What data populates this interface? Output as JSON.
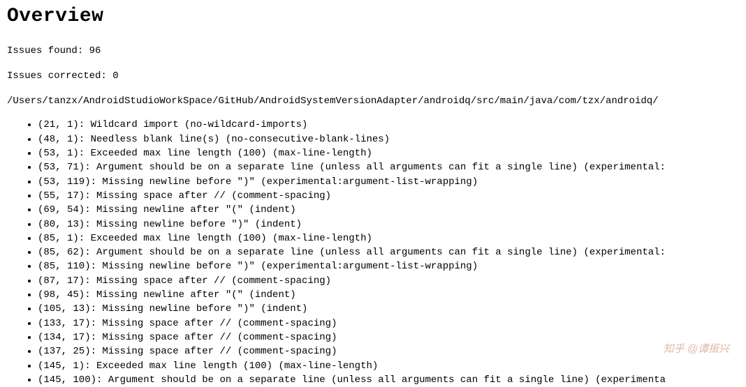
{
  "heading": "Overview",
  "issues_found_label": "Issues found:",
  "issues_found_count": "96",
  "issues_corrected_label": "Issues corrected:",
  "issues_corrected_count": "0",
  "file_path": "/Users/tanzx/AndroidStudioWorkSpace/GitHub/AndroidSystemVersionAdapter/androidq/src/main/java/com/tzx/androidq/",
  "issues": [
    {
      "text": "(21, 1): Wildcard import (no-wildcard-imports)"
    },
    {
      "text": "(48, 1): Needless blank line(s) (no-consecutive-blank-lines)"
    },
    {
      "text": "(53, 1): Exceeded max line length (100) (max-line-length)"
    },
    {
      "text": "(53, 71): Argument should be on a separate line (unless all arguments can fit a single line) (experimental:"
    },
    {
      "text": "(53, 119): Missing newline before \")\" (experimental:argument-list-wrapping)"
    },
    {
      "text": "(55, 17): Missing space after // (comment-spacing)"
    },
    {
      "text": "(69, 54): Missing newline after \"(\" (indent)"
    },
    {
      "text": "(80, 13): Missing newline before \")\" (indent)"
    },
    {
      "text": "(85, 1): Exceeded max line length (100) (max-line-length)"
    },
    {
      "text": "(85, 62): Argument should be on a separate line (unless all arguments can fit a single line) (experimental:"
    },
    {
      "text": "(85, 110): Missing newline before \")\" (experimental:argument-list-wrapping)"
    },
    {
      "text": "(87, 17): Missing space after // (comment-spacing)"
    },
    {
      "text": "(98, 45): Missing newline after \"(\" (indent)"
    },
    {
      "text": "(105, 13): Missing newline before \")\" (indent)"
    },
    {
      "text": "(133, 17): Missing space after // (comment-spacing)"
    },
    {
      "text": "(134, 17): Missing space after // (comment-spacing)"
    },
    {
      "text": "(137, 25): Missing space after // (comment-spacing)"
    },
    {
      "text": "(145, 1): Exceeded max line length (100) (max-line-length)"
    },
    {
      "text": "(145, 100): Argument should be on a separate line (unless all arguments can fit a single line) (experimenta"
    }
  ],
  "watermark": "知乎 @谭振兴"
}
